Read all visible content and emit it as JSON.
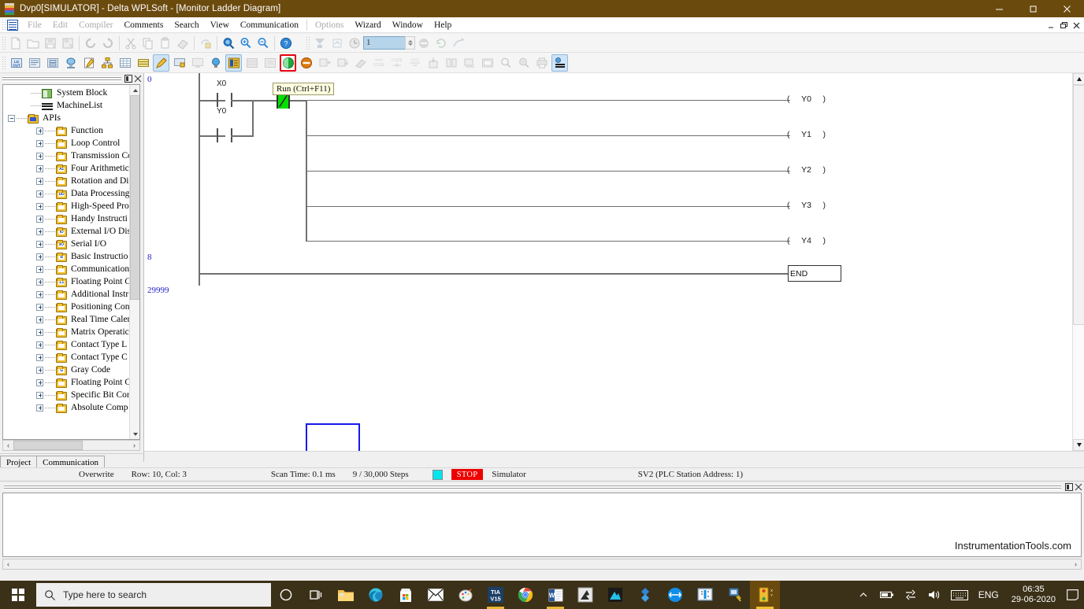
{
  "window": {
    "title": "Dvp0[SIMULATOR] - Delta WPLSoft - [Monitor Ladder Diagram]",
    "minimize": "–",
    "maximize": "❐",
    "close": "✕"
  },
  "mdi": {
    "minimize": "_",
    "restore": "❐",
    "close": "✕"
  },
  "menu": {
    "items": [
      {
        "label": "File",
        "disabled": true
      },
      {
        "label": "Edit",
        "disabled": true
      },
      {
        "label": "Compiler",
        "disabled": true
      },
      {
        "label": "Comments",
        "disabled": false
      },
      {
        "label": "Search",
        "disabled": false
      },
      {
        "label": "View",
        "disabled": false
      },
      {
        "label": "Communication",
        "disabled": false
      },
      {
        "label": "Options",
        "disabled": true
      },
      {
        "label": "Wizard",
        "disabled": false
      },
      {
        "label": "Window",
        "disabled": false
      },
      {
        "label": "Help",
        "disabled": false
      }
    ]
  },
  "toolbar1": {
    "zoom_value": "1",
    "buttons": [
      "new-file-icon",
      "open-file-icon",
      "save-icon",
      "save-as-icon",
      "undo-icon",
      "redo-icon",
      "cut-icon",
      "copy-icon",
      "paste-icon",
      "eraser-icon",
      "print-preview-icon",
      "zoom-find-icon",
      "zoom-in-icon",
      "zoom-out-icon",
      "help-icon",
      "download-icon",
      "upload-icon",
      "clock-icon"
    ],
    "buttons_right": [
      "stop-icon",
      "refresh-icon",
      "run-arrow-icon"
    ]
  },
  "toolbar2": {
    "buttons": [
      "ladder-view-icon",
      "instruction-list-icon",
      "sfc-icon",
      "simulator-icon",
      "edit-comment-icon",
      "network-icon",
      "device-table-icon",
      "register-table-icon",
      "pen-edit-icon",
      "monitor-screen-icon",
      "monitor-off-icon",
      "bulb-icon",
      "ladder-monitor-icon",
      "table-grey-icon",
      "report-grey-icon",
      "run-plc-icon",
      "stop-plc-icon",
      "write-plc-icon",
      "read-plc-icon",
      "broadcast-icon",
      "code-write-icon",
      "code-read-icon",
      "code-compare-icon",
      "download-device-icon",
      "compare-icon",
      "merge-icon",
      "register-edit-icon",
      "search-device-icon",
      "search-instruction-icon",
      "print-device-icon",
      "settings-icon"
    ],
    "selected": [
      "pen-edit-icon",
      "ladder-monitor-icon",
      "settings-icon"
    ],
    "highlighted_red": "run-plc-icon"
  },
  "left_panel": {
    "pin_label": "⊞",
    "close_label": "✕",
    "tabs": [
      {
        "label": "Project",
        "active": true
      },
      {
        "label": "Communication",
        "active": false
      }
    ],
    "tree": [
      {
        "label": "System Block",
        "level": 2,
        "icon": "system-block-icon",
        "expander": "none"
      },
      {
        "label": "MachineList",
        "level": 2,
        "icon": "machine-list-icon",
        "expander": "none"
      },
      {
        "label": "APIs",
        "level": 1,
        "icon": "apis-folder-icon",
        "expander": "minus"
      },
      {
        "label": "Function",
        "level": 3,
        "icon": "folder-icon",
        "expander": "plus",
        "badge": ""
      },
      {
        "label": "Loop Control",
        "level": 3,
        "icon": "folder-icon",
        "expander": "plus",
        "badge": ""
      },
      {
        "label": "Transmission Co",
        "level": 3,
        "icon": "folder-icon",
        "expander": "plus",
        "badge": ""
      },
      {
        "label": "Four Arithmetic",
        "level": 3,
        "icon": "folder-icon",
        "expander": "plus",
        "badge": "A1"
      },
      {
        "label": "Rotation and Di",
        "level": 3,
        "icon": "folder-icon",
        "expander": "plus",
        "badge": ""
      },
      {
        "label": "Data Processing",
        "level": 3,
        "icon": "folder-icon",
        "expander": "plus",
        "badge": "DD"
      },
      {
        "label": "High-Speed Pro",
        "level": 3,
        "icon": "folder-icon",
        "expander": "plus",
        "badge": ""
      },
      {
        "label": "Handy Instructi",
        "level": 3,
        "icon": "folder-icon",
        "expander": "plus",
        "badge": ""
      },
      {
        "label": "External I/O Dis",
        "level": 3,
        "icon": "folder-icon",
        "expander": "plus",
        "badge": "IO"
      },
      {
        "label": "Serial I/O",
        "level": 3,
        "icon": "folder-icon",
        "expander": "plus",
        "badge": "I/O"
      },
      {
        "label": "Basic Instructio",
        "level": 3,
        "icon": "folder-icon",
        "expander": "plus",
        "badge": "B"
      },
      {
        "label": "Communication",
        "level": 3,
        "icon": "folder-icon",
        "expander": "plus",
        "badge": ""
      },
      {
        "label": "Floating Point C",
        "level": 3,
        "icon": "folder-icon",
        "expander": "plus",
        "badge": "1.1"
      },
      {
        "label": "Additional Instr",
        "level": 3,
        "icon": "folder-icon",
        "expander": "plus",
        "badge": ""
      },
      {
        "label": "Positioning Con",
        "level": 3,
        "icon": "folder-icon",
        "expander": "plus",
        "badge": ""
      },
      {
        "label": "Real Time Calen",
        "level": 3,
        "icon": "folder-icon",
        "expander": "plus",
        "badge": ""
      },
      {
        "label": "Matrix Operatic",
        "level": 3,
        "icon": "folder-icon",
        "expander": "plus",
        "badge": ""
      },
      {
        "label": "Contact Type L",
        "level": 3,
        "icon": "folder-icon",
        "expander": "plus",
        "badge": ""
      },
      {
        "label": "Contact Type C",
        "level": 3,
        "icon": "folder-icon",
        "expander": "plus",
        "badge": ""
      },
      {
        "label": "Gray Code",
        "level": 3,
        "icon": "folder-icon",
        "expander": "plus",
        "badge": "G"
      },
      {
        "label": "Floating Point C",
        "level": 3,
        "icon": "folder-icon",
        "expander": "plus",
        "badge": ""
      },
      {
        "label": "Specific Bit Cor",
        "level": 3,
        "icon": "folder-icon",
        "expander": "plus",
        "badge": ""
      },
      {
        "label": "Absolute Comp",
        "level": 3,
        "icon": "folder-icon",
        "expander": "plus",
        "badge": ""
      }
    ],
    "hscroll_left": "‹",
    "hscroll_right": "›"
  },
  "ladder": {
    "rung_numbers": [
      "0",
      "8",
      "29999"
    ],
    "contacts": [
      {
        "name": "X0",
        "type": "no"
      },
      {
        "name": "Y0",
        "type": "no"
      }
    ],
    "nc_contact": {
      "name": "",
      "type": "nc",
      "energized": true
    },
    "tooltip": "Run (Ctrl+F11)",
    "coils": [
      "Y0",
      "Y1",
      "Y2",
      "Y3",
      "Y4"
    ],
    "coil_open": "(",
    "coil_close": ")",
    "end_label": "END"
  },
  "statusbar": {
    "mode": "Overwrite",
    "cursor": "Row: 10, Col: 3",
    "scan_time": "Scan Time: 0.1 ms",
    "steps": "9 / 30,000 Steps",
    "plc_state": "STOP",
    "connection": "Simulator",
    "device": "SV2 (PLC Station Address: 1)"
  },
  "output_panel": {
    "pin_label": "⊞",
    "close_label": "✕",
    "watermark": "InstrumentationTools.com"
  },
  "taskbar": {
    "start_label": "start-button",
    "search_placeholder": "Type here to search",
    "pinned": [
      {
        "name": "cortana-icon",
        "glyph": "◯"
      },
      {
        "name": "task-view-icon",
        "glyph": "❏"
      },
      {
        "name": "file-explorer-icon",
        "glyph": ""
      },
      {
        "name": "edge-icon",
        "glyph": ""
      },
      {
        "name": "microsoft-store-icon",
        "glyph": ""
      },
      {
        "name": "mail-icon",
        "glyph": ""
      },
      {
        "name": "paint-icon",
        "glyph": ""
      },
      {
        "name": "tia-portal-icon",
        "glyph": "TIA V15"
      },
      {
        "name": "chrome-icon",
        "glyph": ""
      },
      {
        "name": "word-icon",
        "glyph": "W"
      },
      {
        "name": "app9-icon",
        "glyph": ""
      },
      {
        "name": "app10-icon",
        "glyph": ""
      },
      {
        "name": "app11-icon",
        "glyph": ""
      },
      {
        "name": "teamviewer-icon",
        "glyph": ""
      },
      {
        "name": "monitor-app-icon",
        "glyph": ""
      },
      {
        "name": "utility-app-icon",
        "glyph": ""
      },
      {
        "name": "wplsoft-icon",
        "glyph": ""
      }
    ],
    "tray": {
      "chevron": "︿",
      "battery": "▭",
      "network": "⇄",
      "volume": "🔊",
      "keyboard": "⌨",
      "language": "ENG",
      "time": "06:35",
      "date": "29-06-2020",
      "action_center": "▢"
    }
  }
}
